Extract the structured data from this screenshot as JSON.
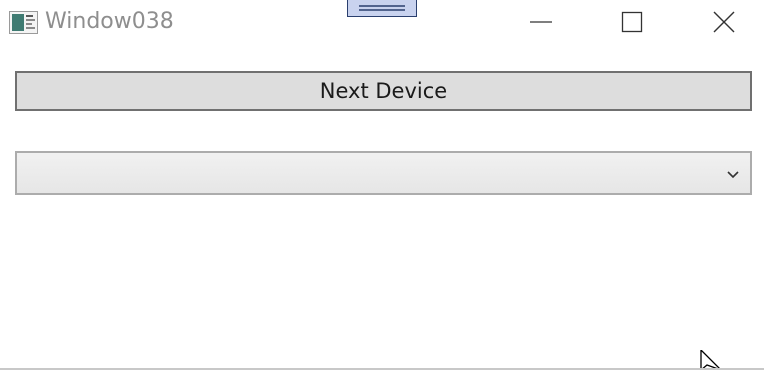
{
  "window": {
    "title": "Window038",
    "app_icon": "app-window-icon"
  },
  "caption_buttons": {
    "minimize_icon": "minimize-icon",
    "maximize_icon": "maximize-icon",
    "close_icon": "close-icon"
  },
  "main": {
    "next_device_label": "Next Device",
    "device_combo": {
      "selected_value": "",
      "arrow_icon": "chevron-down-icon"
    }
  },
  "colors": {
    "button_bg": "#dddddd",
    "button_border": "#707070",
    "title_text": "#8e8e8e",
    "handle_bg": "#c9d3ef"
  }
}
